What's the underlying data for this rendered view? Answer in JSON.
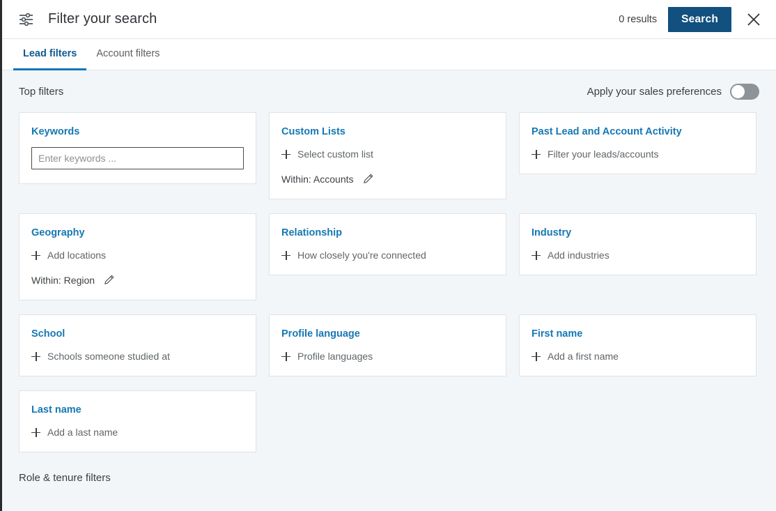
{
  "header": {
    "icon": "sliders-filter-icon",
    "title": "Filter your search",
    "results_text": "0 results",
    "search_label": "Search",
    "close_icon": "close-icon",
    "accent_color": "#11507f"
  },
  "tabs": [
    {
      "label": "Lead filters",
      "active": true
    },
    {
      "label": "Account filters",
      "active": false
    }
  ],
  "top_section": {
    "title": "Top filters",
    "preference_label": "Apply your sales preferences",
    "preference_enabled": false
  },
  "cards": [
    {
      "title": "Keywords",
      "type": "input",
      "placeholder": "Enter keywords ...",
      "value": ""
    },
    {
      "title": "Custom Lists",
      "type": "add",
      "add_label": "Select custom list",
      "within_label": "Within: Accounts",
      "edit_icon": "pencil-icon"
    },
    {
      "title": "Past Lead and Account Activity",
      "type": "add",
      "add_label": "Filter your leads/accounts"
    },
    {
      "title": "Geography",
      "type": "add",
      "add_label": "Add locations",
      "within_label": "Within: Region",
      "edit_icon": "pencil-icon"
    },
    {
      "title": "Relationship",
      "type": "add",
      "add_label": "How closely you're connected"
    },
    {
      "title": "Industry",
      "type": "add",
      "add_label": "Add industries"
    },
    {
      "title": "School",
      "type": "add",
      "add_label": "Schools someone studied at"
    },
    {
      "title": "Profile language",
      "type": "add",
      "add_label": "Profile languages"
    },
    {
      "title": "First name",
      "type": "add",
      "add_label": "Add a first name"
    },
    {
      "title": "Last name",
      "type": "add",
      "add_label": "Add a last name"
    }
  ],
  "bottom_section": {
    "title": "Role & tenure filters"
  }
}
